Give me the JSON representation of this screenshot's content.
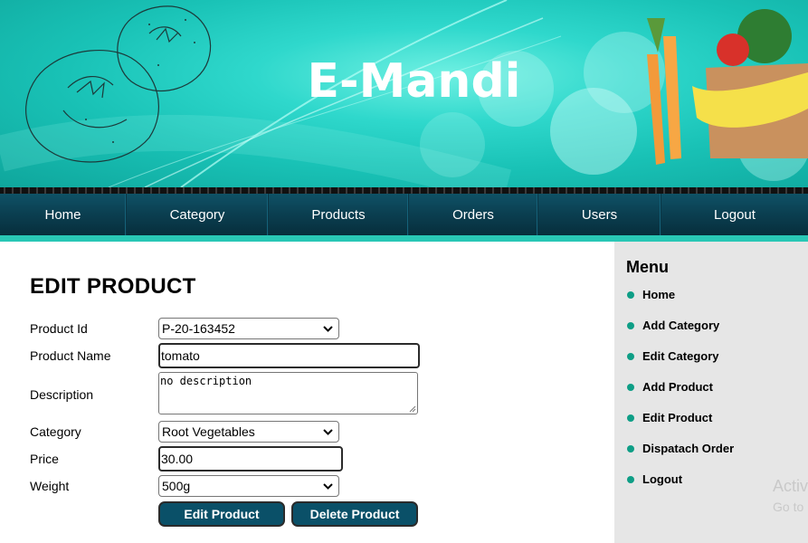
{
  "site": {
    "title": "E-Mandi"
  },
  "nav": {
    "items": [
      {
        "label": "Home"
      },
      {
        "label": "Category"
      },
      {
        "label": "Products"
      },
      {
        "label": "Orders"
      },
      {
        "label": "Users"
      },
      {
        "label": "Logout"
      }
    ]
  },
  "form": {
    "title": "EDIT PRODUCT",
    "product_id": {
      "label": "Product Id",
      "value": "P-20-163452"
    },
    "product_name": {
      "label": "Product Name",
      "value": "tomato"
    },
    "description": {
      "label": "Description",
      "value": "no description"
    },
    "category": {
      "label": "Category",
      "value": "Root Vegetables"
    },
    "price": {
      "label": "Price",
      "value": "30.00"
    },
    "weight": {
      "label": "Weight",
      "value": "500g"
    },
    "edit_button": "Edit Product",
    "delete_button": "Delete Product"
  },
  "sidebar": {
    "title": "Menu",
    "items": [
      {
        "label": "Home"
      },
      {
        "label": "Add Category"
      },
      {
        "label": "Edit Category"
      },
      {
        "label": "Add Product"
      },
      {
        "label": "Edit Product"
      },
      {
        "label": "Dispatach Order"
      },
      {
        "label": "Logout"
      }
    ],
    "watermark_line1": "Activ",
    "watermark_line2": "Go to"
  },
  "colors": {
    "banner": "#19c2b6",
    "nav": "#0b4052",
    "accent": "#29c7b5",
    "button": "#0a5068",
    "bullet": "#0e9e86"
  },
  "icons": [
    "tomato-sketch-icon",
    "vegetable-bag-icon",
    "chevron-down-icon",
    "resize-grip-icon"
  ]
}
